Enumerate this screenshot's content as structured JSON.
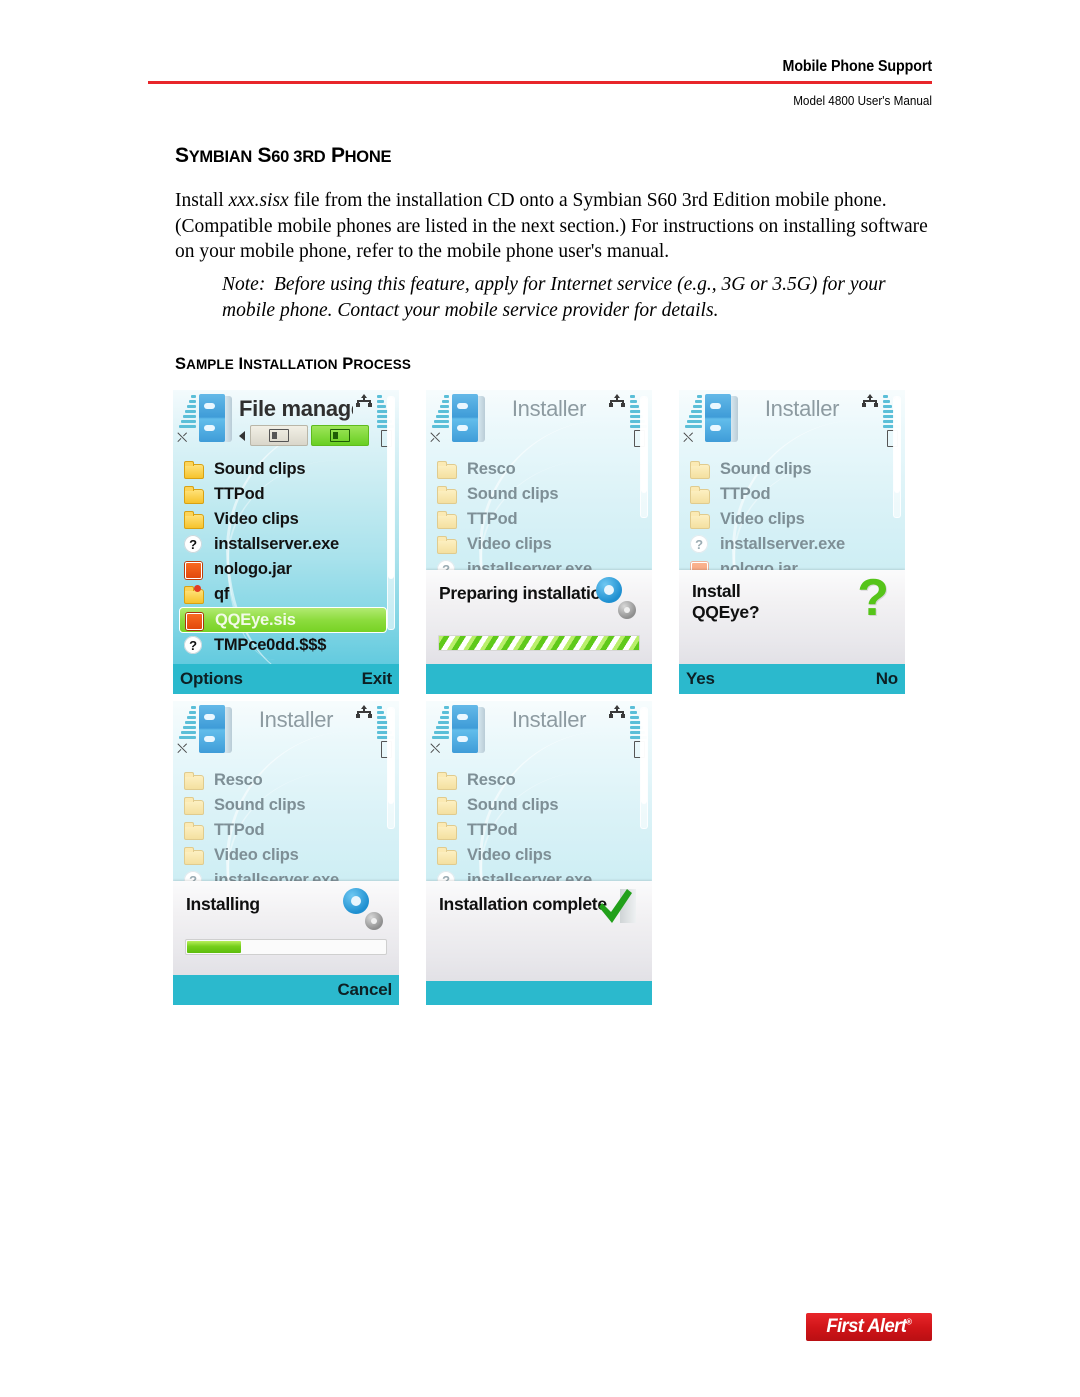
{
  "header": {
    "title": "Mobile Phone Support",
    "subtitle": "Model 4800 User's Manual",
    "rule_color": "#e8262a"
  },
  "section": {
    "heading_first": "S",
    "heading_rest_1": "YMBIAN",
    "heading_s60": " S",
    "heading_s60_sc": "60 3",
    "heading_rd": "RD",
    "heading_p": " P",
    "heading_hone": "HONE",
    "heading_plain": "SYMBIAN S60 3RD PHONE"
  },
  "body": {
    "p1_a": "Install ",
    "p1_italic": "xxx.sisx",
    "p1_b": " file from the installation CD onto a Symbian S60 3rd Edition mobile phone. (Compatible mobile phones are listed in the next section.) For instructions on installing software on your mobile phone, refer to the mobile phone user's manual.",
    "note_label": "Note:",
    "note_text": "Before using this feature, apply for Internet service (e.g., 3G or 3.5G) for your mobile phone. Contact your mobile service provider for details."
  },
  "subsection": {
    "heading_plain": "SAMPLE INSTALLATION PROCESS",
    "s": "S",
    "ample": "AMPLE",
    "i": " I",
    "nstallation": "NSTALLATION",
    "p": " P",
    "rocess": "ROCESS"
  },
  "phones": [
    {
      "id": "file-manager",
      "title": "File manager",
      "title_dim": false,
      "has_memtabs": true,
      "files": [
        {
          "name": "Sound clips",
          "icon": "folder",
          "selected": false
        },
        {
          "name": "TTPod",
          "icon": "folder",
          "selected": false
        },
        {
          "name": "Video clips",
          "icon": "folder",
          "selected": false
        },
        {
          "name": "installserver.exe",
          "icon": "qmark",
          "selected": false
        },
        {
          "name": "nologo.jar",
          "icon": "sq",
          "selected": false
        },
        {
          "name": "qf",
          "icon": "folder-dot",
          "selected": false
        },
        {
          "name": "QQEye.sis",
          "icon": "sq",
          "selected": true
        },
        {
          "name": "TMPce0dd.$$$",
          "icon": "qmark",
          "selected": false
        }
      ],
      "softkey_left": "Options",
      "softkey_right": "Exit",
      "dialog": null
    },
    {
      "id": "preparing",
      "title": "Installer",
      "title_dim": true,
      "has_memtabs": false,
      "files": [
        {
          "name": "Resco",
          "icon": "folder",
          "selected": false
        },
        {
          "name": "Sound clips",
          "icon": "folder",
          "selected": false
        },
        {
          "name": "TTPod",
          "icon": "folder",
          "selected": false
        },
        {
          "name": "Video clips",
          "icon": "folder",
          "selected": false
        },
        {
          "name": "installserver.exe",
          "icon": "qmark",
          "selected": false
        }
      ],
      "softkey_left": "",
      "softkey_right": "",
      "dialog": {
        "kind": "progress-striped",
        "text": "Preparing installation",
        "icon": "gear-icon",
        "progress_percent": 100
      }
    },
    {
      "id": "confirm",
      "title": "Installer",
      "title_dim": true,
      "has_memtabs": false,
      "files": [
        {
          "name": "Sound clips",
          "icon": "folder",
          "selected": false
        },
        {
          "name": "TTPod",
          "icon": "folder",
          "selected": false
        },
        {
          "name": "Video clips",
          "icon": "folder",
          "selected": false
        },
        {
          "name": "installserver.exe",
          "icon": "qmark",
          "selected": false
        },
        {
          "name": "nologo.jar",
          "icon": "sq",
          "selected": false
        }
      ],
      "softkey_left": "Yes",
      "softkey_right": "No",
      "dialog": {
        "kind": "confirm",
        "text_line1": "Install",
        "text_line2": "QQEye?",
        "icon": "question-mark-icon"
      }
    },
    {
      "id": "installing",
      "title": "Installer",
      "title_dim": true,
      "has_memtabs": false,
      "files": [
        {
          "name": "Resco",
          "icon": "folder",
          "selected": false
        },
        {
          "name": "Sound clips",
          "icon": "folder",
          "selected": false
        },
        {
          "name": "TTPod",
          "icon": "folder",
          "selected": false
        },
        {
          "name": "Video clips",
          "icon": "folder",
          "selected": false
        },
        {
          "name": "installserver.exe",
          "icon": "qmark",
          "selected": false
        }
      ],
      "softkey_left": "",
      "softkey_right": "Cancel",
      "dialog": {
        "kind": "progress-solid",
        "text": "Installing",
        "icon": "gear-icon",
        "progress_percent": 27
      }
    },
    {
      "id": "complete",
      "title": "Installer",
      "title_dim": true,
      "has_memtabs": false,
      "files": [
        {
          "name": "Resco",
          "icon": "folder",
          "selected": false
        },
        {
          "name": "Sound clips",
          "icon": "folder",
          "selected": false
        },
        {
          "name": "TTPod",
          "icon": "folder",
          "selected": false
        },
        {
          "name": "Video clips",
          "icon": "folder",
          "selected": false
        },
        {
          "name": "installserver.exe",
          "icon": "qmark",
          "selected": false
        }
      ],
      "softkey_left": "",
      "softkey_right": "",
      "dialog": {
        "kind": "complete",
        "text": "Installation complete",
        "icon": "green-check-icon"
      }
    }
  ],
  "footer": {
    "logo_text": "First Alert",
    "logo_reg": "®",
    "logo_color": "#d21419"
  }
}
